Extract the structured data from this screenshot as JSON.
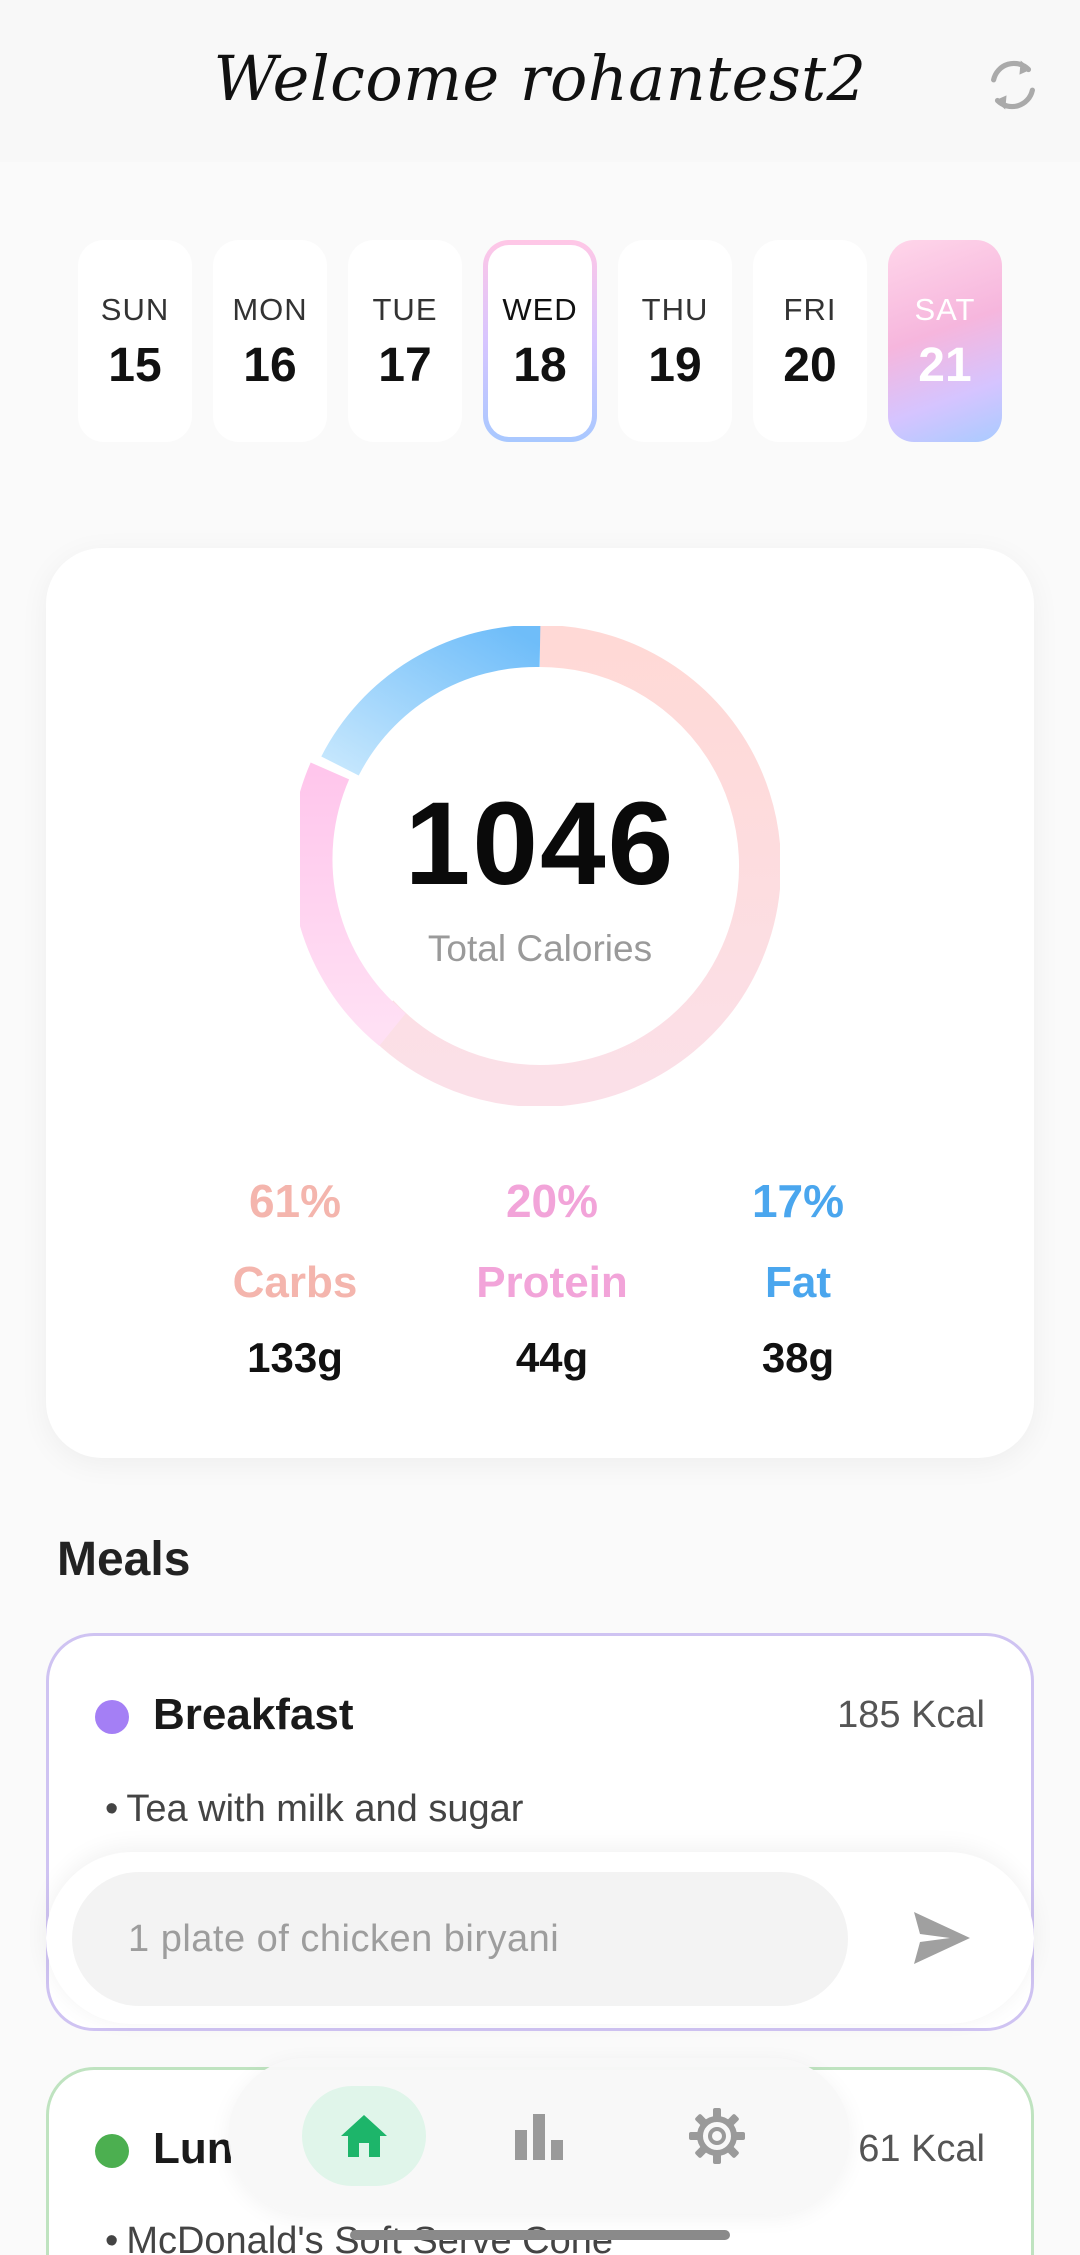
{
  "header": {
    "welcome": "Welcome rohantest2",
    "refresh_icon": "refresh-icon"
  },
  "days": [
    {
      "name": "SUN",
      "date": "15"
    },
    {
      "name": "MON",
      "date": "16"
    },
    {
      "name": "TUE",
      "date": "17"
    },
    {
      "name": "WED",
      "date": "18"
    },
    {
      "name": "THU",
      "date": "19"
    },
    {
      "name": "FRI",
      "date": "20"
    },
    {
      "name": "SAT",
      "date": "21"
    }
  ],
  "selected_day": "WED",
  "today": "SAT",
  "calories": {
    "total": "1046",
    "label": "Total Calories",
    "ring_colors": {
      "carbs": "#ffd9d6",
      "protein": "#ffccee",
      "fat": "#7fc6fb"
    }
  },
  "macros": [
    {
      "pct": "61%",
      "name": "Carbs",
      "grams": "133g",
      "color": "#f4b5ad"
    },
    {
      "pct": "20%",
      "name": "Protein",
      "grams": "44g",
      "color": "#f2a4d9"
    },
    {
      "pct": "17%",
      "name": "Fat",
      "grams": "38g",
      "color": "#4aa6ee"
    }
  ],
  "meals_title": "Meals",
  "meals": [
    {
      "name": "Breakfast",
      "kcal": "185 Kcal",
      "items": [
        "Tea with milk and sugar"
      ],
      "dot_color": "#a47ff5"
    },
    {
      "name": "Lun",
      "kcal": "61 Kcal",
      "items": [
        "McDonald's Soft Serve Cone"
      ],
      "dot_color": "#4caf50"
    }
  ],
  "input": {
    "placeholder": "1 plate of chicken biryani",
    "send_icon": "send-icon"
  },
  "nav": {
    "items": [
      "home-icon",
      "bar-chart-icon",
      "gear-icon"
    ],
    "active": "home-icon",
    "active_color": "#1db56a"
  }
}
